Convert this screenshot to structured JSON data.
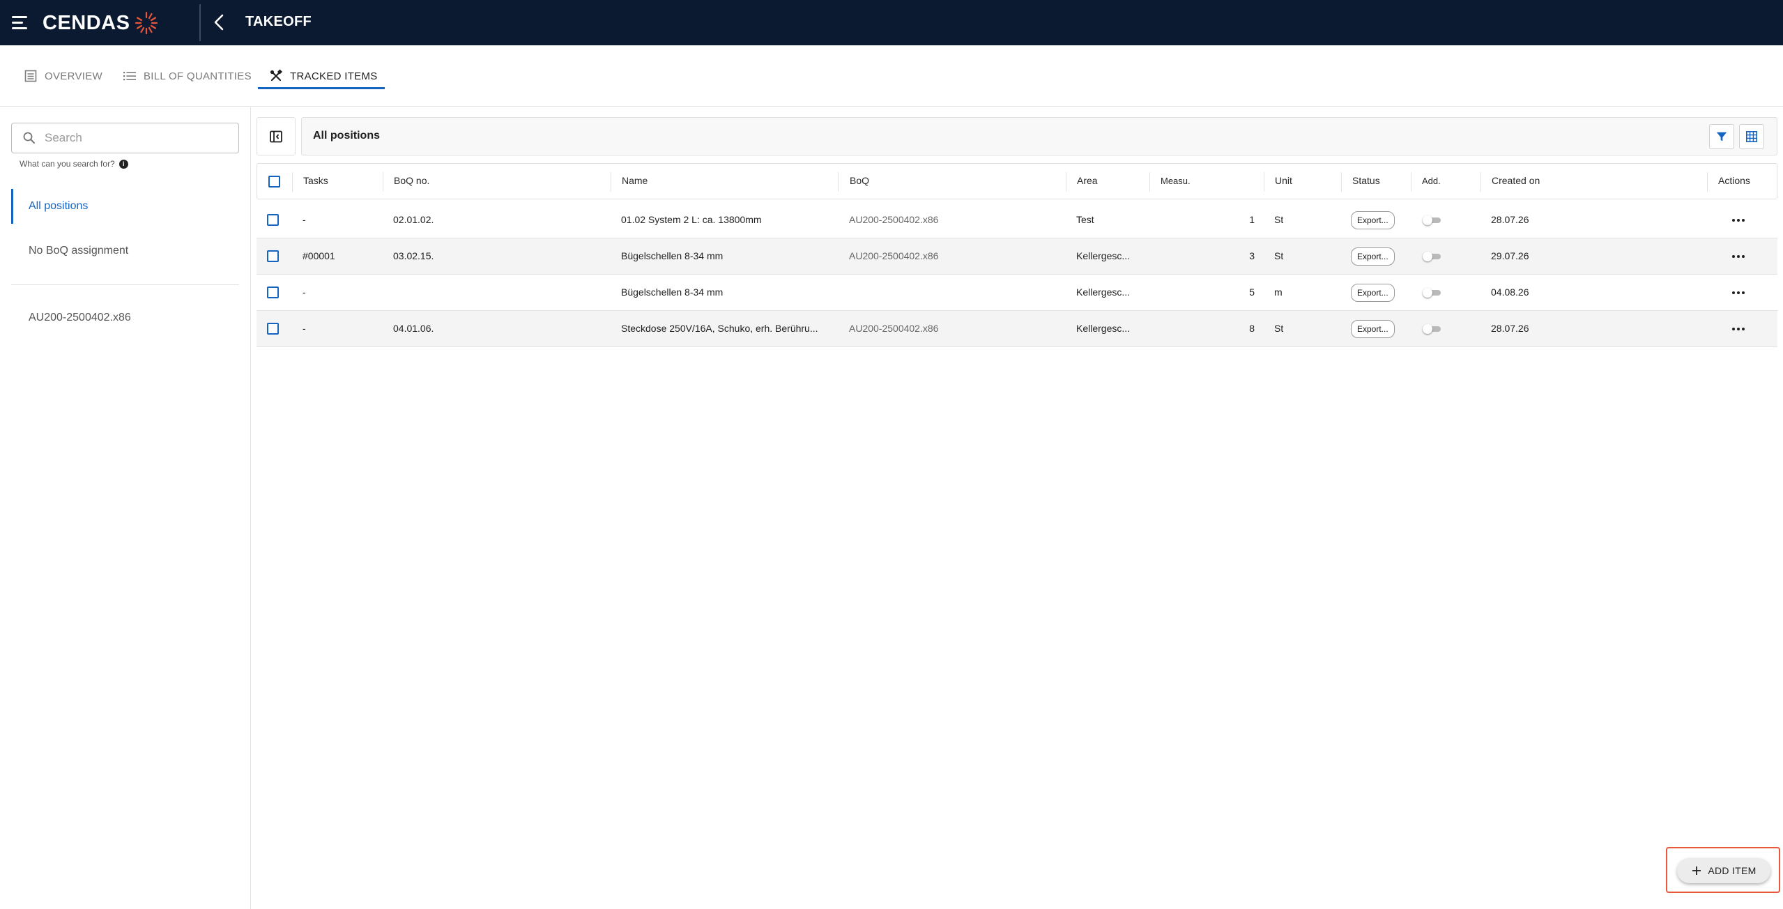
{
  "app": {
    "brand": "CENDAS",
    "title": "TAKEOFF",
    "accent_color": "#1565c0",
    "topbar_color": "#0b1a30",
    "logo_mark_color": "#e8563b"
  },
  "tabs": [
    {
      "label": "OVERVIEW",
      "icon": "list-box-icon",
      "active": false
    },
    {
      "label": "BILL OF QUANTITIES",
      "icon": "list-icon",
      "active": false
    },
    {
      "label": "TRACKED ITEMS",
      "icon": "tools-icon",
      "active": true
    }
  ],
  "sidebar": {
    "search_placeholder": "Search",
    "search_hint": "What can you search for?",
    "items": [
      {
        "label": "All positions",
        "active": true
      },
      {
        "label": "No BoQ assignment",
        "active": false
      },
      {
        "label": "AU200-2500402.x86",
        "active": false
      }
    ]
  },
  "main": {
    "header_title": "All positions"
  },
  "table": {
    "columns": [
      "Tasks",
      "BoQ no.",
      "Name",
      "BoQ",
      "Area",
      "Measu.",
      "Unit",
      "Status",
      "Add.",
      "Created on",
      "Actions"
    ],
    "rows": [
      {
        "tasks": "-",
        "boq_no": "02.01.02.",
        "name": "01.02 System 2 L: ca. 13800mm",
        "boq": "AU200-2500402.x86",
        "area": "Test",
        "measure": "1",
        "unit": "St",
        "status": "Export...",
        "add": false,
        "created": "28.07.26"
      },
      {
        "tasks": "#00001",
        "boq_no": "03.02.15.",
        "name": "Bügelschellen 8-34 mm",
        "boq": "AU200-2500402.x86",
        "area": "Kellergesc...",
        "measure": "3",
        "unit": "St",
        "status": "Export...",
        "add": false,
        "created": "29.07.26"
      },
      {
        "tasks": "-",
        "boq_no": "",
        "name": "Bügelschellen 8-34 mm",
        "boq": "",
        "area": "Kellergesc...",
        "measure": "5",
        "unit": "m",
        "status": "Export...",
        "add": false,
        "created": "04.08.26"
      },
      {
        "tasks": "-",
        "boq_no": "04.01.06.",
        "name": "Steckdose 250V/16A, Schuko, erh. Berühru...",
        "boq": "AU200-2500402.x86",
        "area": "Kellergesc...",
        "measure": "8",
        "unit": "St",
        "status": "Export...",
        "add": false,
        "created": "28.07.26"
      }
    ]
  },
  "add_button": {
    "label": "ADD ITEM",
    "icon": "plus-icon"
  }
}
